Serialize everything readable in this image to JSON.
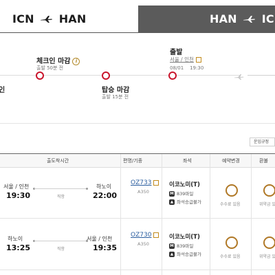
{
  "tabs": [
    {
      "from": "ICN",
      "to": "HAN",
      "active": true
    },
    {
      "from": "HAN",
      "to": "ICN",
      "active": false
    }
  ],
  "timeline": {
    "left_fragment": "인",
    "checkin": {
      "title": "체크인 마감",
      "sub": "출발 50분 전"
    },
    "boarding": {
      "title": "탑승 마감",
      "sub": "출발 15분 전"
    },
    "departure": {
      "title": "출발",
      "city": "서울 / 인천",
      "date": "08/01",
      "time": "19:30"
    }
  },
  "rules_button": "운임규정",
  "table": {
    "headers": {
      "schedule": "출도착시간",
      "flight": "편명/기종",
      "seat": "좌석",
      "change": "예약변경",
      "refund": "환불"
    },
    "rows": [
      {
        "dep_city": "서울 / 인천",
        "dep_time": "19:30",
        "arr_city": "하노이",
        "arr_time": "22:00",
        "direct": "직항",
        "flight_no": "OZ733",
        "aircraft": "A350",
        "cabin": "이코노미(T)",
        "miles": "839마일",
        "seat_note": "좌석승급불가",
        "change_fee": "수수료 있음",
        "refund_fee": "위약금 있"
      },
      {
        "dep_city": "하노이",
        "dep_time": "13:25",
        "arr_city": "서울 / 인천",
        "arr_time": "19:35",
        "direct": "직항",
        "flight_no": "OZ730",
        "aircraft": "A350",
        "cabin": "이코노미(T)",
        "miles": "839마일",
        "seat_note": "좌석승급불가",
        "change_fee": "수수료 있음",
        "refund_fee": "위약금 있"
      }
    ]
  },
  "colors": {
    "accent_red": "#c9142b",
    "gold": "#b07826",
    "link_blue": "#2a5d9f",
    "tab_dark": "#5b5b5b"
  }
}
